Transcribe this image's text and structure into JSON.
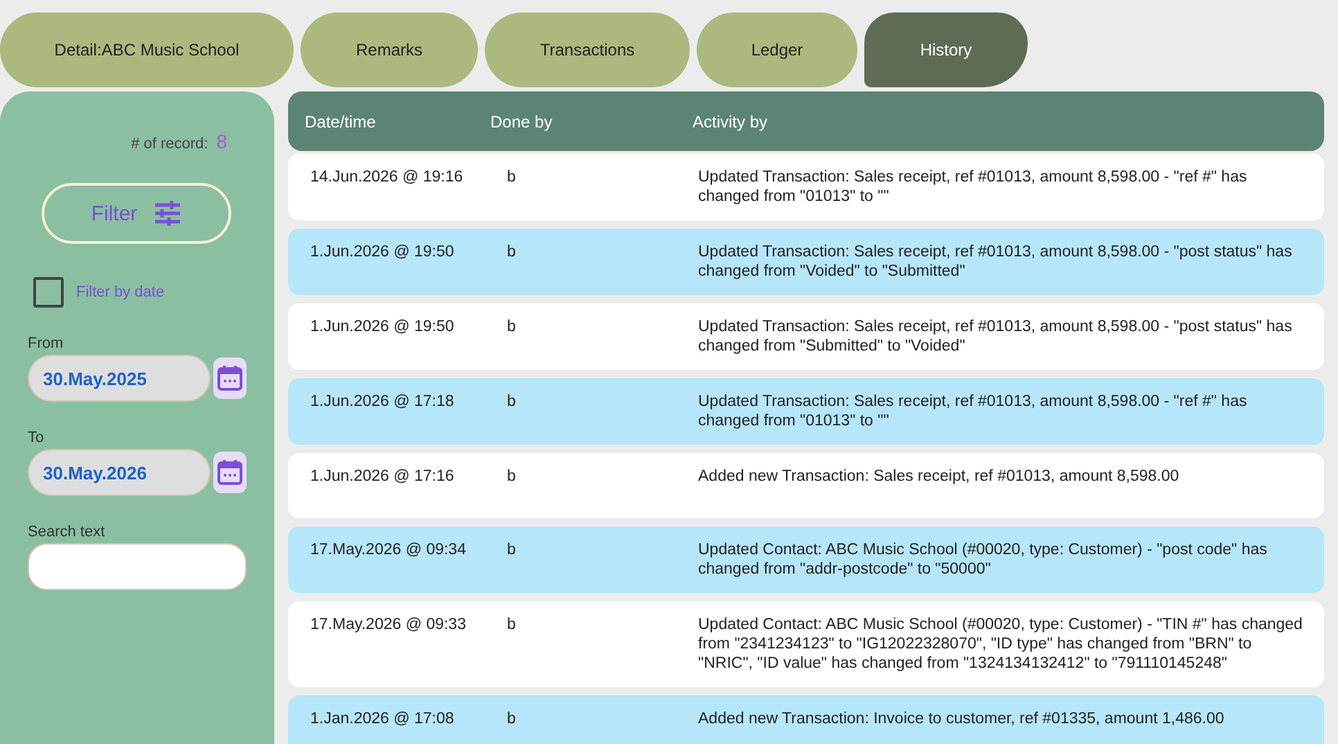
{
  "tabs": [
    {
      "label": "Detail:ABC Music School",
      "selected": false
    },
    {
      "label": "Remarks",
      "selected": false
    },
    {
      "label": "Transactions",
      "selected": false
    },
    {
      "label": "Ledger",
      "selected": false
    },
    {
      "label": "History",
      "selected": true
    }
  ],
  "sidebar": {
    "record_label": "# of record:",
    "record_count": "8",
    "filter_button": "Filter",
    "filter_by_date": {
      "label": "Filter by date",
      "checked": false
    },
    "from_label": "From",
    "from_value": "30.May.2025",
    "to_label": "To",
    "to_value": "30.May.2026",
    "search_label": "Search text"
  },
  "table": {
    "columns": [
      "Date/time",
      "Done by",
      "Activity by"
    ],
    "rows": [
      {
        "datetime": "14.Jun.2026 @ 19:16",
        "done_by": "b",
        "activity": "Updated Transaction: Sales receipt, ref #01013, amount 8,598.00 - \"ref #\" has changed from \"01013\" to \"\""
      },
      {
        "datetime": "1.Jun.2026 @ 19:50",
        "done_by": "b",
        "activity": "Updated Transaction: Sales receipt, ref #01013, amount 8,598.00 - \"post status\" has changed from \"Voided\" to \"Submitted\""
      },
      {
        "datetime": "1.Jun.2026 @ 19:50",
        "done_by": "b",
        "activity": "Updated Transaction: Sales receipt, ref #01013, amount 8,598.00 - \"post status\" has changed from \"Submitted\" to \"Voided\""
      },
      {
        "datetime": "1.Jun.2026 @ 17:18",
        "done_by": "b",
        "activity": "Updated Transaction: Sales receipt, ref #01013, amount 8,598.00 - \"ref #\" has changed from \"01013\" to \"\""
      },
      {
        "datetime": "1.Jun.2026 @ 17:16",
        "done_by": "b",
        "activity": "Added new Transaction: Sales receipt, ref #01013, amount 8,598.00"
      },
      {
        "datetime": "17.May.2026 @ 09:34",
        "done_by": "b",
        "activity": "Updated Contact: ABC Music School (#00020, type: Customer) - \"post code\" has changed from \"addr-postcode\" to \"50000\""
      },
      {
        "datetime": "17.May.2026 @ 09:33",
        "done_by": "b",
        "activity": "Updated Contact: ABC Music School (#00020, type: Customer) - \"TIN #\" has changed from \"2341234123\" to \"IG12022328070\", \"ID type\" has changed from \"BRN\" to \"NRIC\", \"ID value\" has changed from \"1324134132412\" to \"791110145248\""
      },
      {
        "datetime": "1.Jan.2026 @ 17:08",
        "done_by": "b",
        "activity": "Added new Transaction: Invoice to customer, ref #01335, amount 1,486.00"
      }
    ]
  }
}
